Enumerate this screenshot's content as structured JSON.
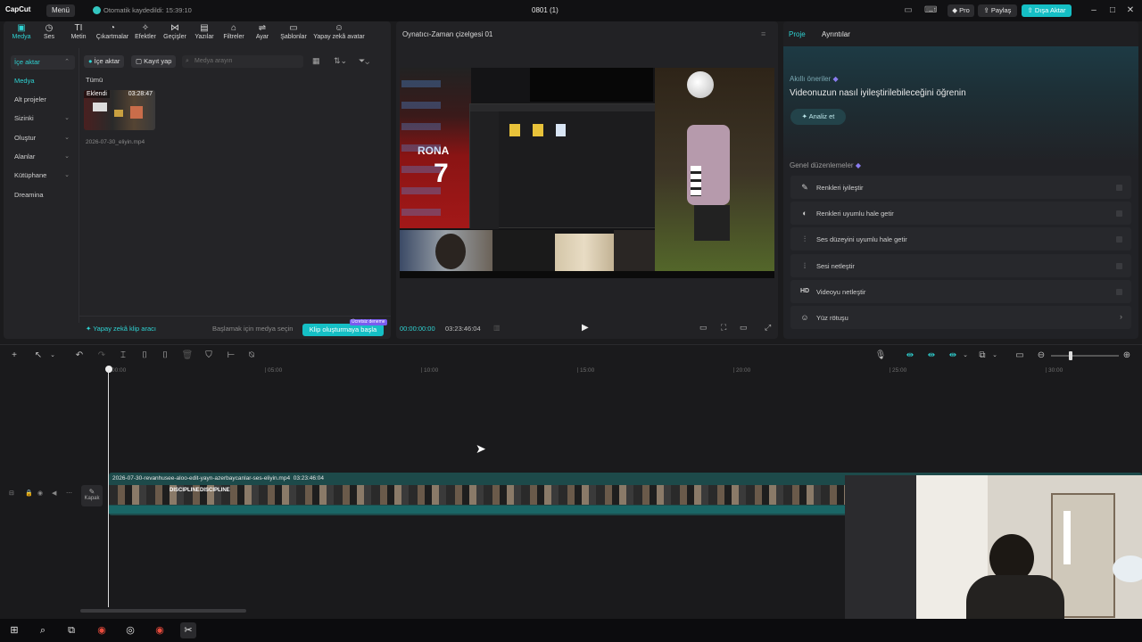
{
  "titlebar": {
    "logo": "CapCut",
    "menu_label": "Menü",
    "autosave_text": "Otomatik kaydedildi: 15:39:10",
    "project_title": "0801 (1)",
    "pro_label": "Pro",
    "share_label": "Paylaş",
    "export_label": "Dışa Aktar"
  },
  "toolbar": {
    "tools": [
      {
        "label": "Medya",
        "icon": "media-icon"
      },
      {
        "label": "Ses",
        "icon": "audio-icon"
      },
      {
        "label": "Metin",
        "icon": "text-icon"
      },
      {
        "label": "Çıkartmalar",
        "icon": "sticker-icon"
      },
      {
        "label": "Efektler",
        "icon": "effects-icon"
      },
      {
        "label": "Geçişler",
        "icon": "transitions-icon"
      },
      {
        "label": "Yazılar",
        "icon": "captions-icon"
      },
      {
        "label": "Filtreler",
        "icon": "filters-icon"
      },
      {
        "label": "Ayar",
        "icon": "adjust-icon"
      },
      {
        "label": "Şablonlar",
        "icon": "templates-icon"
      },
      {
        "label": "Yapay zekâ avatar",
        "icon": "avatar-icon"
      }
    ]
  },
  "sidebar": {
    "items": [
      {
        "label": "İçe aktar"
      },
      {
        "label": "Medya"
      },
      {
        "label": "Alt projeler"
      },
      {
        "label": "Sizinki"
      },
      {
        "label": "Oluştur"
      },
      {
        "label": "Alanlar"
      },
      {
        "label": "Kütüphane"
      },
      {
        "label": "Dreamina"
      }
    ]
  },
  "media": {
    "import_btn": "İçe aktar",
    "record_btn": "Kayıt yap",
    "search_placeholder": "Medya arayın",
    "filter_all": "Tümü",
    "thumb_added": "Eklendi",
    "thumb_duration": "03:28:47",
    "thumb_name": "2026-07-30_eliyin.mp4",
    "ai_clip_tool": "Yapay zekâ klip aracı",
    "hint": "Başlamak için medya seçin",
    "create_clip_btn": "Klip oluşturmaya başla",
    "trial_badge": "Ücretsiz deneme"
  },
  "player": {
    "title": "Oynatıcı-Zaman çizelgesi 01",
    "current_time": "00:00:00:00",
    "total_time": "03:23:46:04",
    "shirt_text": "RONA",
    "shirt_number": "7"
  },
  "right_panel": {
    "tab_project": "Proje",
    "tab_details": "Ayrıntılar",
    "smart_title": "Akıllı öneriler",
    "smart_heading": "Videonuzun nasıl iyileştirilebileceğini öğrenin",
    "analyze_btn": "Analiz et",
    "general_title": "Genel düzenlemeler",
    "items": [
      {
        "label": "Renkleri iyileştir",
        "icon": "magic-wand-icon"
      },
      {
        "label": "Renkleri uyumlu hale getir",
        "icon": "color-match-icon"
      },
      {
        "label": "Ses düzeyini uyumlu hale getir",
        "icon": "volume-levels-icon"
      },
      {
        "label": "Sesi netleştir",
        "icon": "audio-enhance-icon"
      },
      {
        "label": "Videoyu netleştir",
        "icon": "hd-icon"
      },
      {
        "label": "Yüz rötuşu",
        "icon": "face-retouch-icon"
      }
    ],
    "hd_text": "HD"
  },
  "timeline": {
    "ticks": [
      "00:00",
      "05:00",
      "10:00",
      "15:00",
      "20:00",
      "25:00",
      "30:00"
    ],
    "clip_name": "2026-07-30-revanhusee-aloo-edit-yayn-azerbaycanlar-ses-eliyin.mp4",
    "clip_duration": "03:23:46:04",
    "cover_label": "Kapak",
    "frame_text": "DISCIPLINE"
  },
  "taskbar": {
    "apps": [
      "windows-start-icon",
      "search-icon",
      "task-view-icon",
      "chrome-icon",
      "obs-icon",
      "chrome-icon",
      "capcut-icon"
    ]
  },
  "colors": {
    "accent": "#15bfc5",
    "panel": "#242427",
    "background": "#1b1b1d"
  }
}
